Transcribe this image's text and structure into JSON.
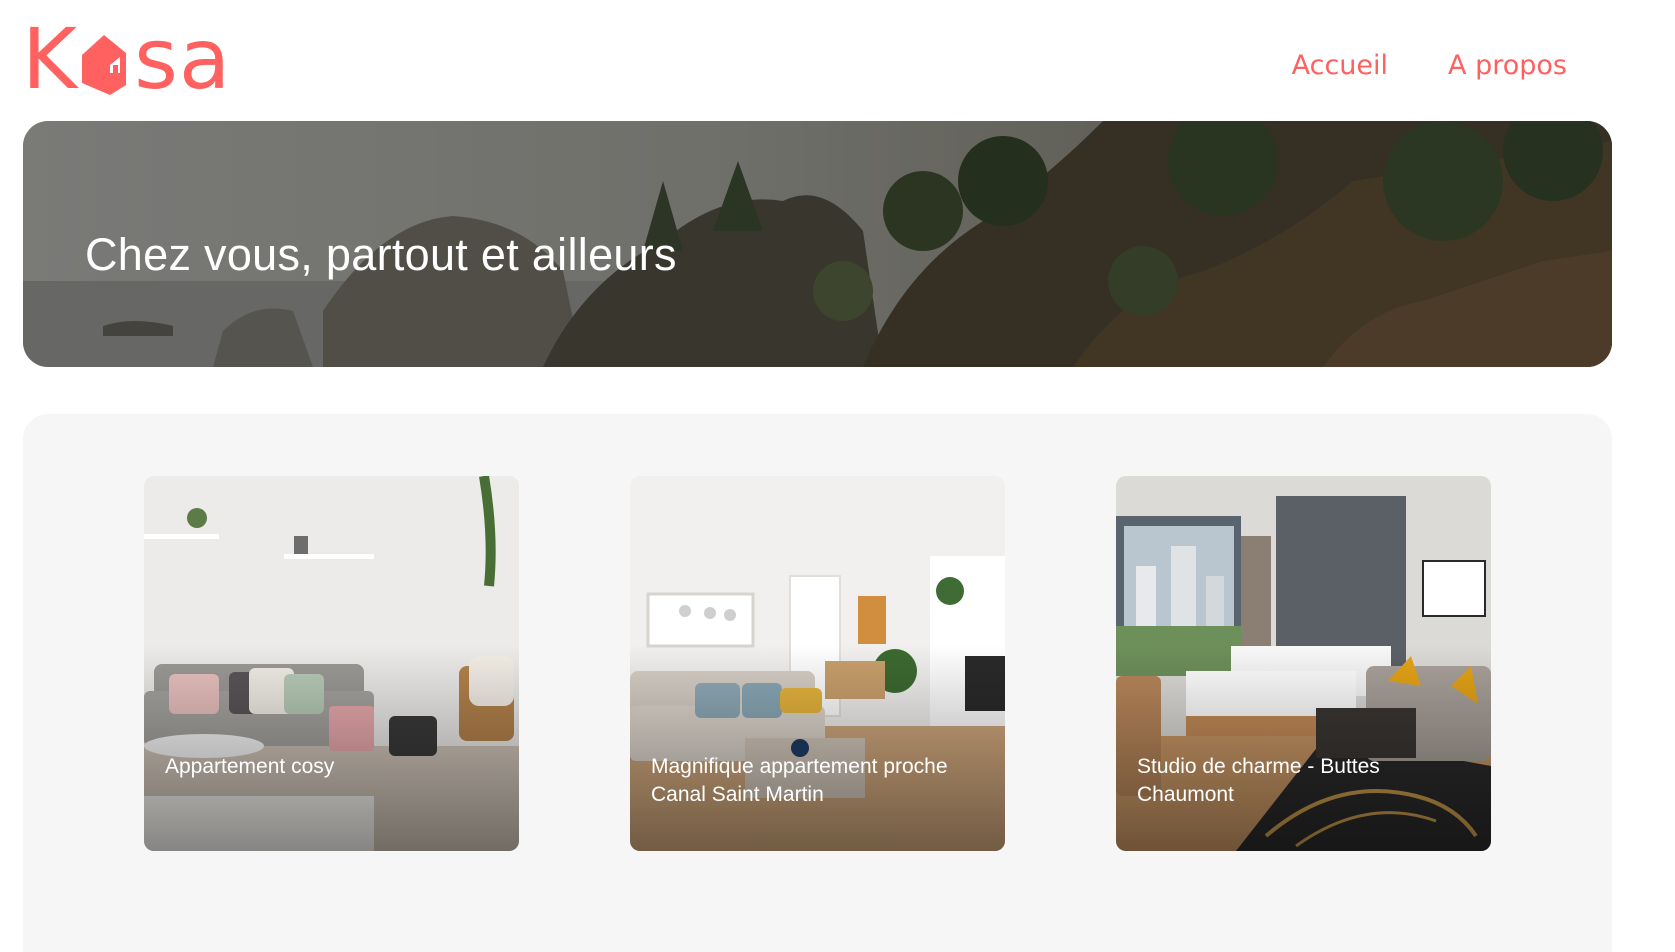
{
  "header": {
    "logo": {
      "part1": "K",
      "part2": "sa",
      "icon": "house-icon"
    },
    "nav": [
      {
        "label": "Accueil"
      },
      {
        "label": "A propos"
      }
    ]
  },
  "banner": {
    "title": "Chez vous, partout et ailleurs"
  },
  "gallery": {
    "cards": [
      {
        "title": "Appartement cosy"
      },
      {
        "title": "Magnifique appartement proche Canal Saint Martin"
      },
      {
        "title": "Studio de charme - Buttes Chaumont"
      }
    ]
  },
  "colors": {
    "brand": "#FF6060",
    "gallery_bg": "#F6F6F6"
  }
}
